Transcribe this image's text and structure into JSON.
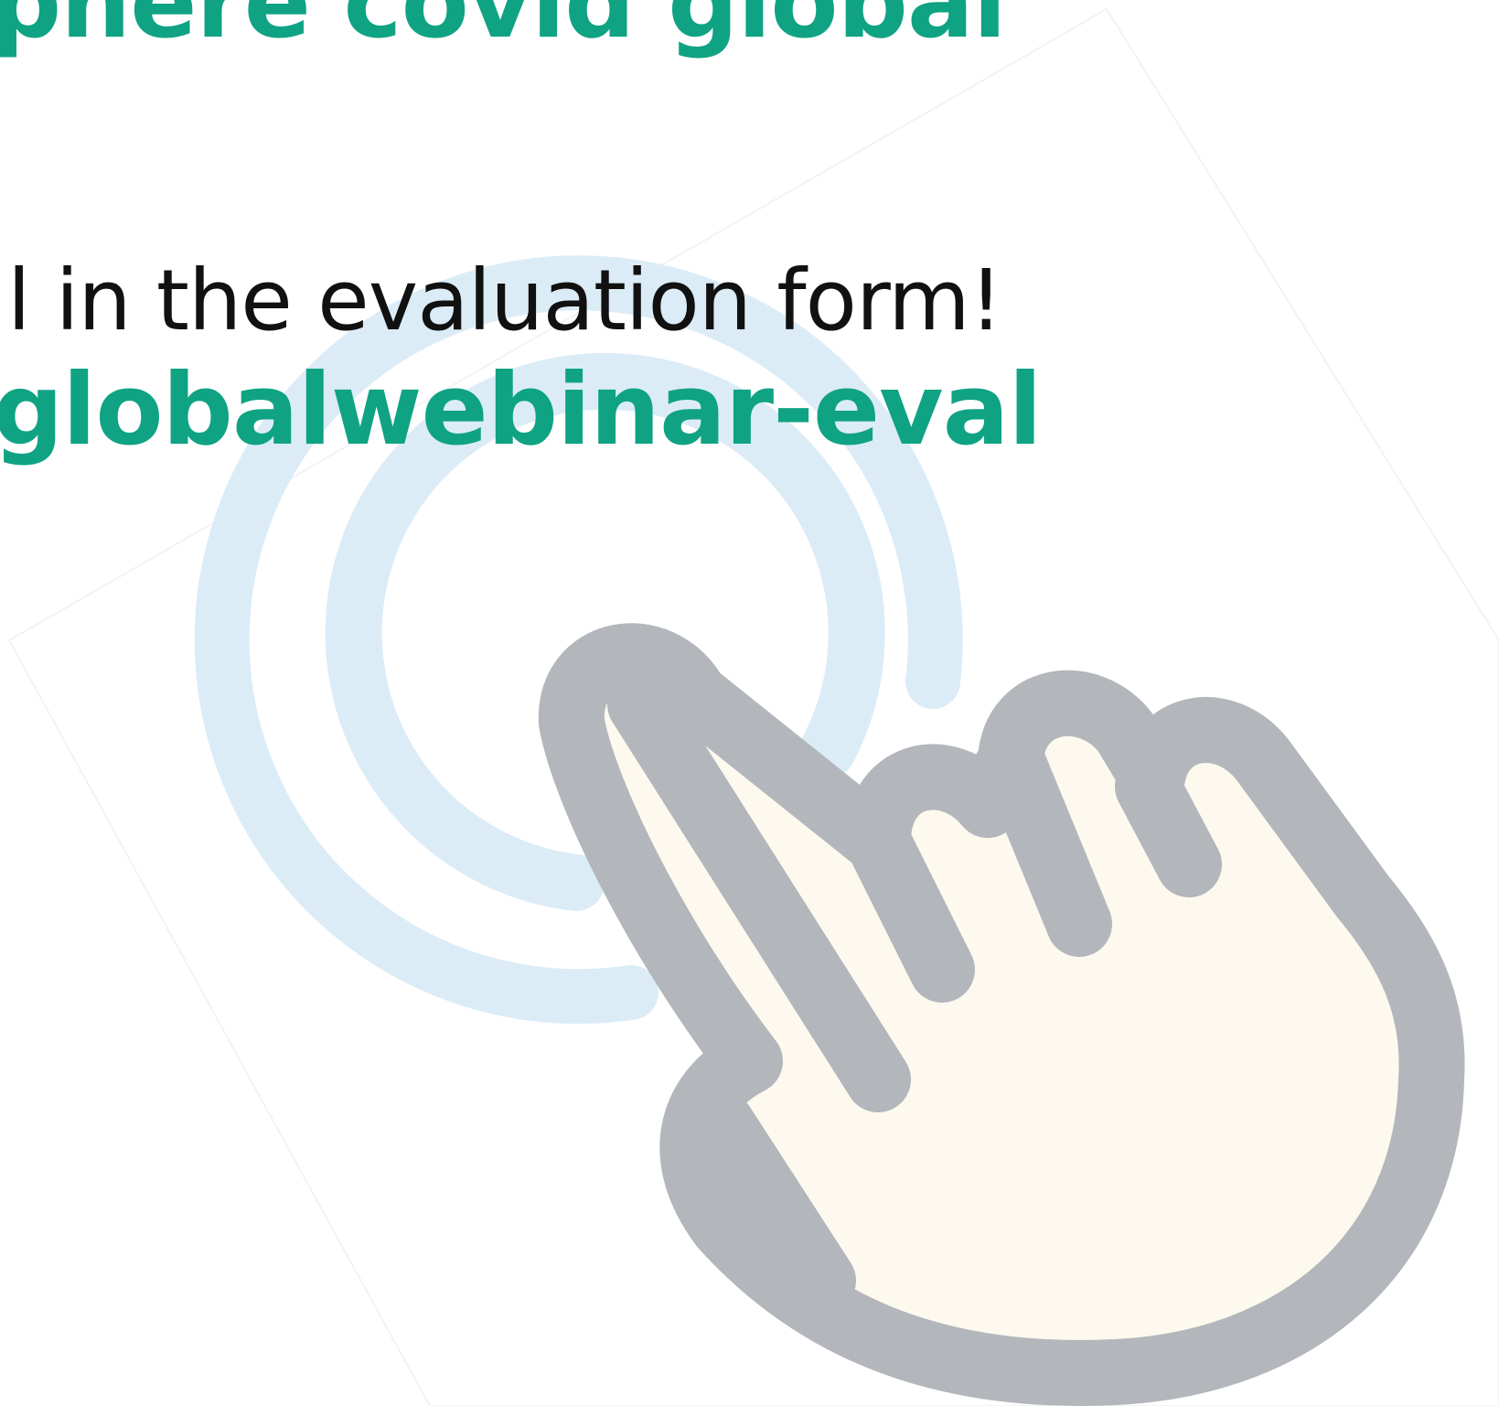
{
  "slide": {
    "title_fragment": "phere covid global",
    "instruction": "l in the evaluation form!",
    "link_fragment": "globalwebinar-eval"
  },
  "graphics": {
    "hand_icon": "tap-hand-icon",
    "ripple_icon": "tap-ripple-icon"
  },
  "colors": {
    "accent": "#0fa383",
    "text": "#111111",
    "hand_outline": "#b3b7bc",
    "hand_fill": "#fdf9ef",
    "ripple": "#dcecf7",
    "background": "#ffffff"
  }
}
